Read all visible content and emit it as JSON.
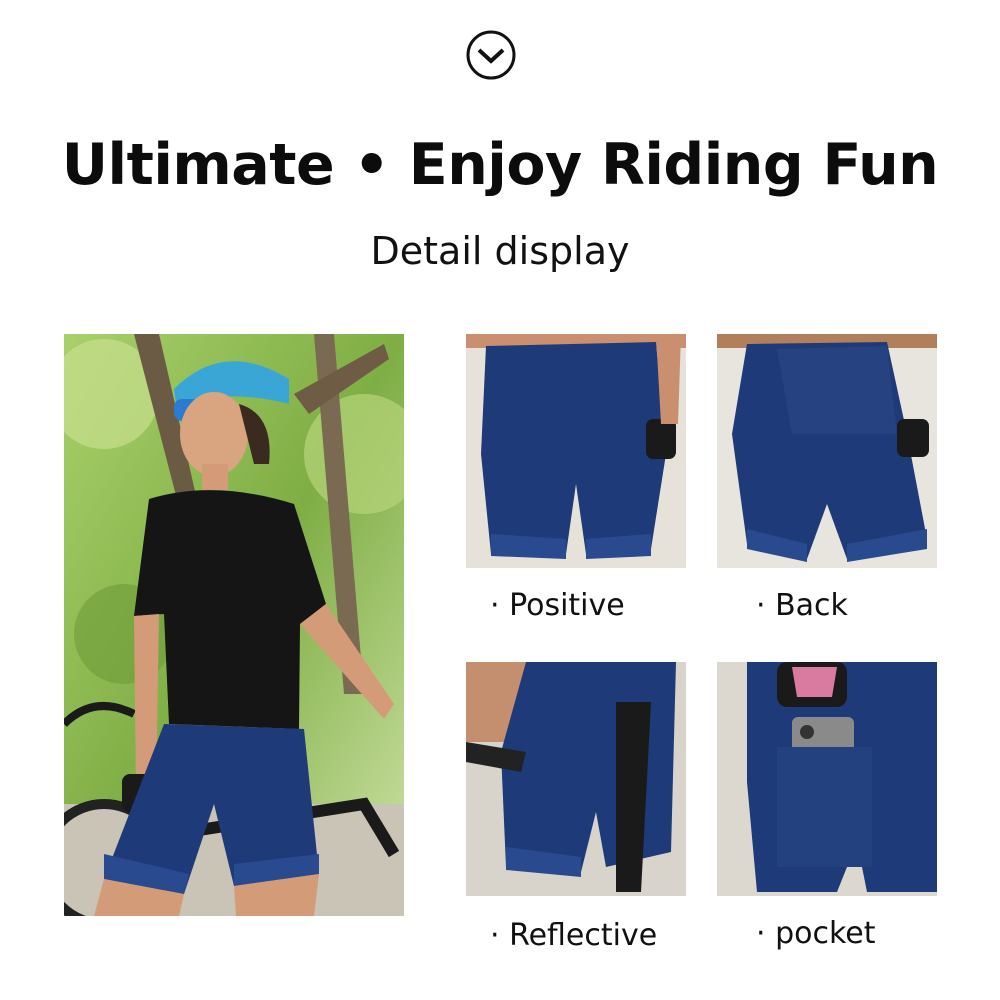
{
  "header": {
    "icon": "chevron-down-circle-icon",
    "title": "Ultimate • Enjoy Riding Fun",
    "subtitle": "Detail display"
  },
  "colors": {
    "navy": "#1f3a78",
    "jersey": "#141414",
    "foliage": "#8fbf52"
  },
  "details": [
    {
      "caption": "· Positive"
    },
    {
      "caption": "· Back"
    },
    {
      "caption": "· Reflective"
    },
    {
      "caption": "· pocket"
    }
  ]
}
